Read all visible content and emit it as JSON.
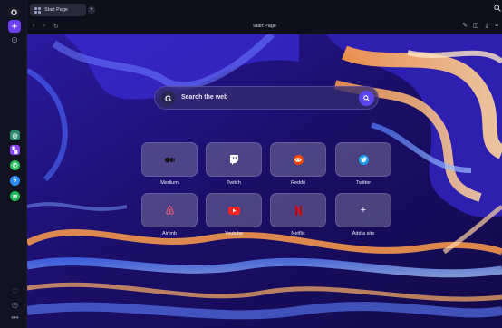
{
  "sidebar": {
    "logo": "O",
    "apps": [
      {
        "name": "chatgpt",
        "color": "#2e8a6e"
      },
      {
        "name": "twitch",
        "color": "#8b46ff"
      },
      {
        "name": "whatsapp",
        "color": "#27c05a"
      },
      {
        "name": "messenger",
        "color": "#2a8cff"
      },
      {
        "name": "spotify",
        "color": "#1db954"
      }
    ]
  },
  "tabs": [
    {
      "label": "Start Page",
      "active": true
    }
  ],
  "address_bar": {
    "url": "Start Page"
  },
  "search": {
    "placeholder": "Search the web",
    "engine_letter": "G"
  },
  "speed_dials": [
    {
      "label": "Medium",
      "icon": "medium-icon"
    },
    {
      "label": "Twitch",
      "icon": "twitch-icon"
    },
    {
      "label": "Reddit",
      "icon": "reddit-icon"
    },
    {
      "label": "Twitter",
      "icon": "twitter-icon"
    },
    {
      "label": "Airbnb",
      "icon": "airbnb-icon"
    },
    {
      "label": "Youtube",
      "icon": "youtube-icon"
    },
    {
      "label": "Netflix",
      "icon": "netflix-icon"
    },
    {
      "label": "Add a site",
      "icon": "plus-icon"
    }
  ],
  "colors": {
    "accent": "#5a44f0",
    "background": "#1a0f5c"
  }
}
